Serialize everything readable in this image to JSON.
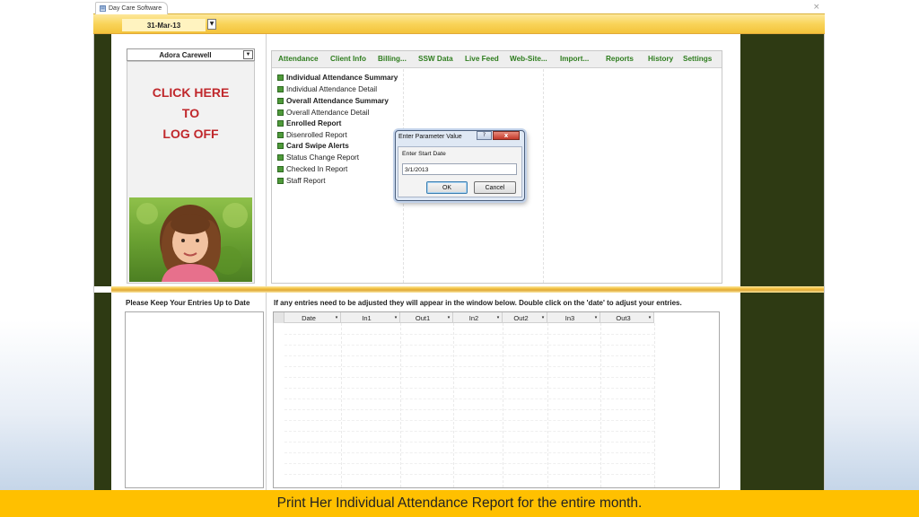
{
  "window": {
    "tab_title": "Day Care Software",
    "close_glyph": "×"
  },
  "header": {
    "date_value": "31-Mar-13",
    "dropdown_glyph": "▼"
  },
  "left_panel": {
    "user_name": "Adora Carewell",
    "logoff_lines": [
      "CLICK HERE",
      "TO",
      "LOG OFF"
    ],
    "photo_alt": "child photo",
    "notes_label": "Please Keep Your Entries Up to Date"
  },
  "nav": {
    "tabs": [
      "Attendance",
      "Client Info",
      "Billing...",
      "SSW Data",
      "Live Feed",
      "Web-Site...",
      "Import...",
      "Reports",
      "History",
      "Settings"
    ]
  },
  "reports": {
    "items": [
      {
        "label": "Individual Attendance Summary",
        "bold": true
      },
      {
        "label": "Individual Attendance Detail",
        "bold": false
      },
      {
        "label": "Overall Attendance Summary",
        "bold": true
      },
      {
        "label": "Overall Attendance Detail",
        "bold": false
      },
      {
        "label": "Enrolled Report",
        "bold": true
      },
      {
        "label": "Disenrolled Report",
        "bold": false
      },
      {
        "label": "Card Swipe Alerts",
        "bold": true
      },
      {
        "label": "Status Change Report",
        "bold": false
      },
      {
        "label": "Checked In Report",
        "bold": false
      },
      {
        "label": "Staff Report",
        "bold": false
      }
    ]
  },
  "dialog": {
    "title": "Enter Parameter Value",
    "help_glyph": "?",
    "close_glyph": "x",
    "prompt": "Enter Start Date",
    "input_value": "3/1/2013",
    "ok_label": "OK",
    "cancel_label": "Cancel"
  },
  "entries": {
    "instructions": "If any entries need to be adjusted they will appear in the window below. Double click on the 'date' to adjust your entries.",
    "columns": [
      "Date",
      "In1",
      "Out1",
      "In2",
      "Out2",
      "In3",
      "Out3"
    ],
    "sort_glyph": "▾"
  },
  "caption": {
    "text": "Print Her Individual Attendance Report for the entire month."
  },
  "colors": {
    "accent_yellow": "#ffc000",
    "side_green": "#2e3a13",
    "nav_green": "#2e7d1e",
    "logoff_red": "#c0282c"
  }
}
